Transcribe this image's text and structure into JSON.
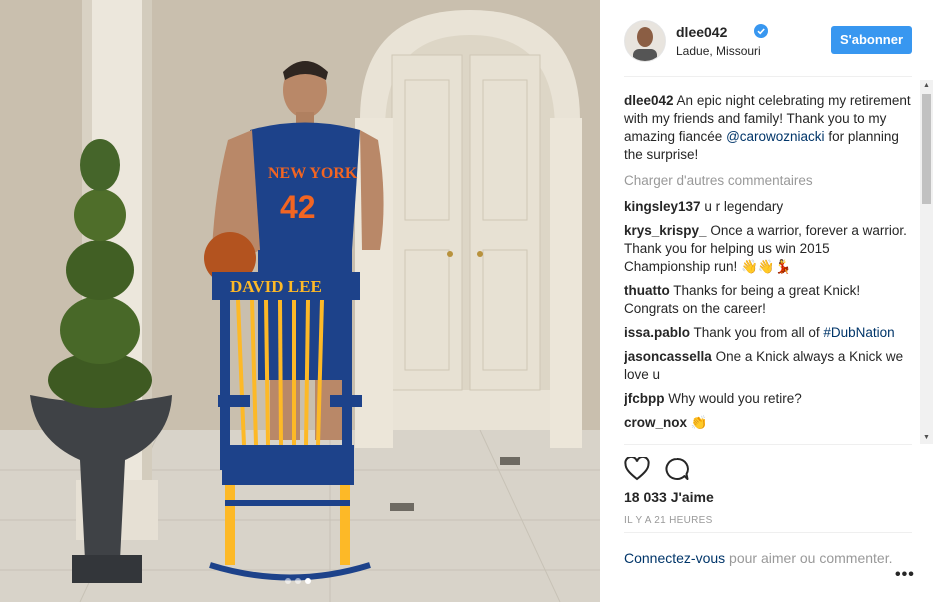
{
  "post": {
    "username": "dlee042",
    "location": "Ladue, Missouri",
    "follow_label": "S'abonner",
    "caption_user": "dlee042",
    "caption_text": " An epic night celebrating my retirement with my friends and family! Thank you to my amazing fiancée ",
    "caption_mention": "@carowozniacki",
    "caption_tail": " for planning the surprise!",
    "load_more": "Charger d'autres commentaires",
    "likes": "18 033 J'aime",
    "time": "IL Y A 21 HEURES",
    "login_link": "Connectez-vous",
    "login_text": " pour aimer ou commenter.",
    "more_label": "•••"
  },
  "comments": [
    {
      "user": "kingsley137",
      "text": " u r legendary"
    },
    {
      "user": "krys_krispy_",
      "text": " Once a warrior, forever a warrior. Thank you for helping us win 2015 Championship run! 👋👋💃"
    },
    {
      "user": "thuatto",
      "text": " Thanks for being a great Knick! Congrats on the career!"
    },
    {
      "user": "issa.pablo",
      "text": " Thank you from all of ",
      "tag": "#DubNation"
    },
    {
      "user": "jasoncassella",
      "text": " One a Knick always a Knick we love u"
    },
    {
      "user": "jfcbpp",
      "text": " Why would you retire?"
    },
    {
      "user": "crow_nox",
      "text": " 👏"
    }
  ],
  "image": {
    "jersey_team": "NEW YORK",
    "jersey_number": "42",
    "chair_name": "DAVID LEE",
    "carousel_index": 3,
    "carousel_count": 3
  },
  "colors": {
    "accent": "#3897f0",
    "link": "#003569",
    "knicks_blue": "#1d428a",
    "warriors_gold": "#fdb927"
  }
}
